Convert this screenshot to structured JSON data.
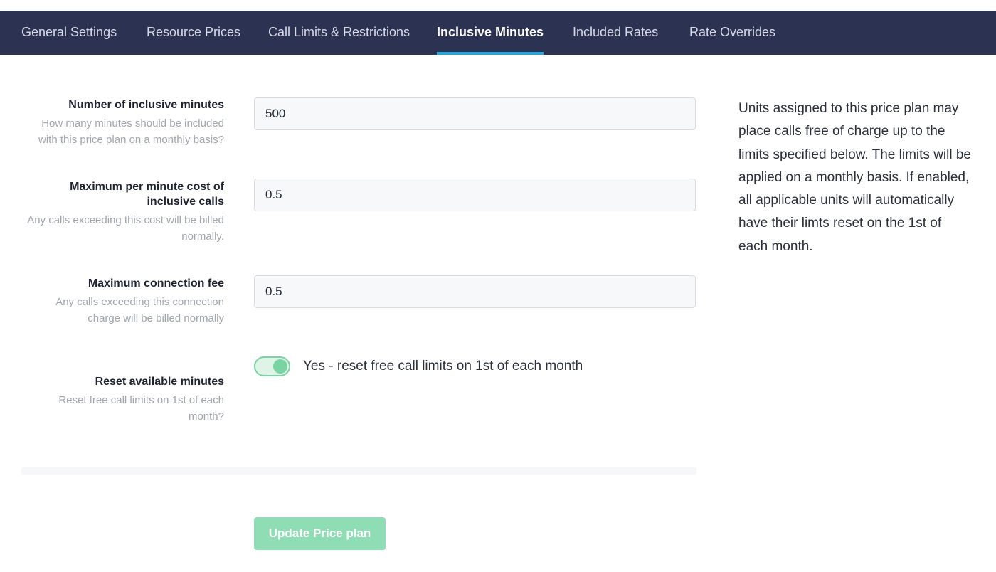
{
  "tabs": [
    {
      "label": "General Settings",
      "active": false
    },
    {
      "label": "Resource Prices",
      "active": false
    },
    {
      "label": "Call Limits & Restrictions",
      "active": false
    },
    {
      "label": "Inclusive Minutes",
      "active": true
    },
    {
      "label": "Included Rates",
      "active": false
    },
    {
      "label": "Rate Overrides",
      "active": false
    }
  ],
  "form": {
    "inclusive_minutes": {
      "label": "Number of inclusive minutes",
      "help": "How many minutes should be included with this price plan on a monthly basis?",
      "value": "500"
    },
    "max_per_minute_cost": {
      "label": "Maximum per minute cost of inclusive calls",
      "help": "Any calls exceeding this cost will be billed normally.",
      "value": "0.5"
    },
    "max_connection_fee": {
      "label": "Maximum connection fee",
      "help": "Any calls exceeding this connection charge will be billed normally",
      "value": "0.5"
    },
    "reset_minutes": {
      "label": "Reset available minutes",
      "help": "Reset free call limits on 1st of each month?",
      "toggle_text": "Yes - reset free call limits on 1st of each month",
      "enabled": true
    },
    "submit_label": "Update Price plan"
  },
  "info": {
    "text": "Units assigned to this price plan may place calls free of charge up to the limits specified below. The limits will be applied on a monthly basis. If enabled, all applicable units will automatically have their limts reset on the 1st of each month."
  },
  "colors": {
    "tabbar_bg": "#2c3352",
    "tab_active_underline": "#1ea7e0",
    "toggle_accent": "#7bd3a3",
    "button_bg": "#8fddb4"
  }
}
